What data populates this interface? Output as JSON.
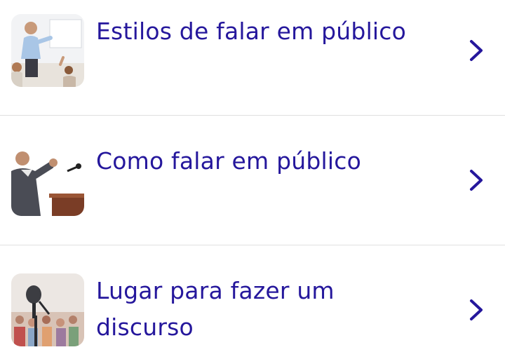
{
  "list": {
    "items": [
      {
        "label": "Estilos de falar em público",
        "icon": "presenter-photo",
        "chevron": "chevron-right-icon"
      },
      {
        "label": "Como falar em público",
        "icon": "speaker-at-podium-photo",
        "chevron": "chevron-right-icon"
      },
      {
        "label": "Lugar para fazer um discurso",
        "icon": "microphone-audience-photo",
        "chevron": "chevron-right-icon"
      }
    ]
  },
  "colors": {
    "text": "#25179c",
    "chevron": "#25179c",
    "divider": "#e0e0e0",
    "background": "#ffffff"
  }
}
